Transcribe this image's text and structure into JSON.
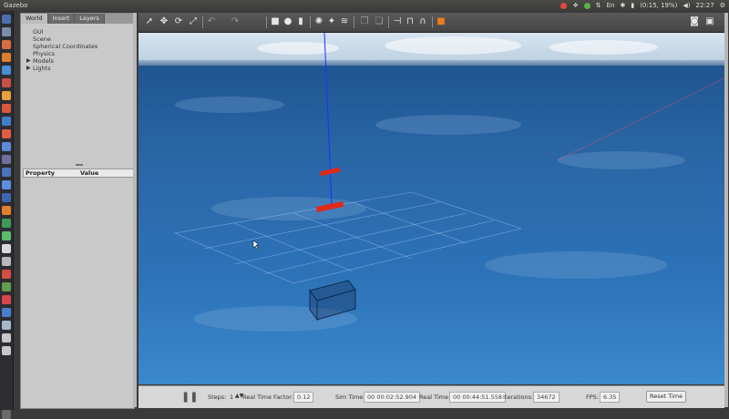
{
  "app": {
    "title": "Gazebo"
  },
  "system": {
    "battery": "(0:15, 19%)",
    "clock": "22:27"
  },
  "left_panel": {
    "tabs": [
      "World",
      "Insert",
      "Layers"
    ],
    "tree": [
      {
        "label": "GUI",
        "expandable": false
      },
      {
        "label": "Scene",
        "expandable": false
      },
      {
        "label": "Spherical Coordinates",
        "expandable": false
      },
      {
        "label": "Physics",
        "expandable": false
      },
      {
        "label": "Models",
        "expandable": true
      },
      {
        "label": "Lights",
        "expandable": true
      }
    ],
    "property_header": {
      "property": "Property",
      "value": "Value"
    }
  },
  "toolbar": {
    "icons": [
      "select-arrow-icon",
      "translate-icon",
      "rotate-icon",
      "scale-icon",
      "undo-icon",
      "redo-icon",
      "box-icon",
      "sphere-icon",
      "cylinder-icon",
      "point-light-icon",
      "spot-light-icon",
      "directional-light-icon",
      "copy-icon",
      "paste-icon",
      "align-icon",
      "snap-icon",
      "magnet-icon",
      "orange-color-icon",
      "screenshot-icon",
      "record-icon"
    ]
  },
  "bottom_bar": {
    "steps_label": "Steps:",
    "steps_value": "1",
    "rtf_label": "Real Time Factor:",
    "rtf_value": "0.12",
    "simtime_label": "Sim Time:",
    "simtime_value": "00 00:02:52.904",
    "realtime_label": "Real Time:",
    "realtime_value": "00 00:44:51.558",
    "iterations_label": "Iterations:",
    "iterations_value": "34672",
    "fps_label": "FPS:",
    "fps_value": "6.35",
    "reset_label": "Reset Time"
  }
}
